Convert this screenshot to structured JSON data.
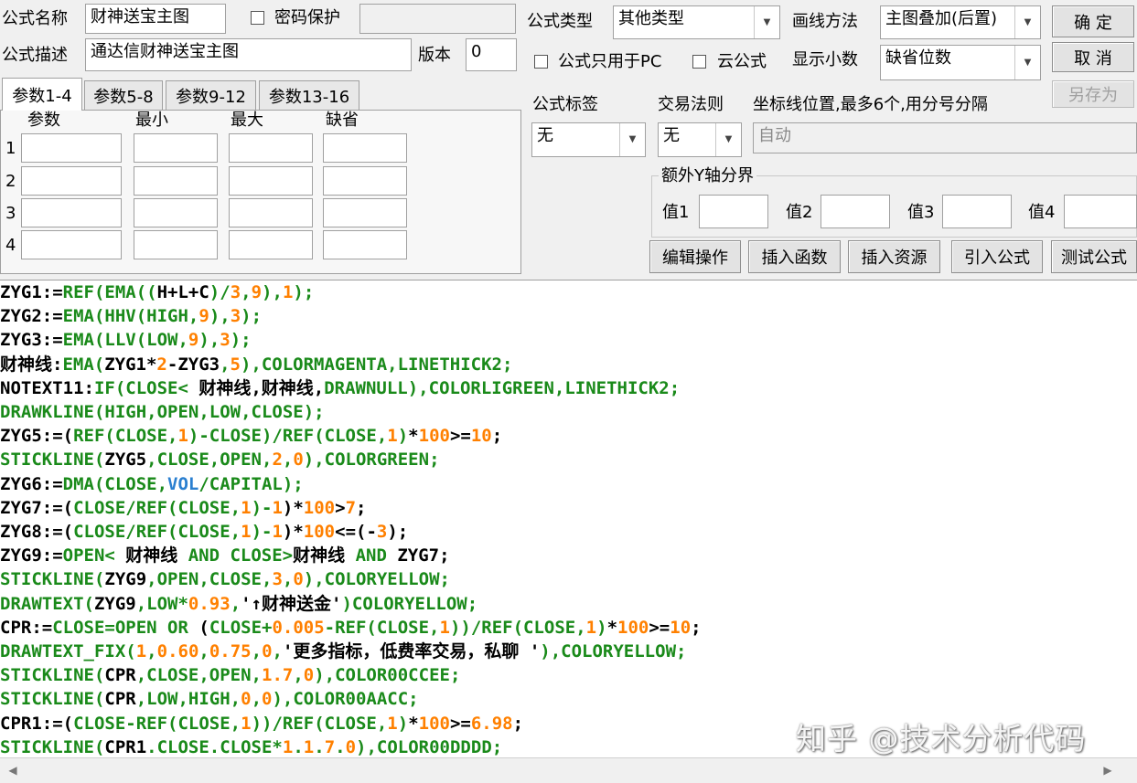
{
  "header": {
    "name_label": "公式名称",
    "name_value": "财神送宝主图",
    "password_label": "密码保护",
    "desc_label": "公式描述",
    "desc_value": "通达信财神送宝主图",
    "version_label": "版本",
    "version_value": "0",
    "type_label": "公式类型",
    "type_value": "其他类型",
    "draw_label": "画线方法",
    "draw_value": "主图叠加(后置)",
    "pc_only_label": "公式只用于PC",
    "cloud_label": "云公式",
    "decimals_label": "显示小数",
    "decimals_value": "缺省位数"
  },
  "buttons": {
    "ok": "确  定",
    "cancel": "取  消",
    "save_as": "另存为",
    "edit_ops": "编辑操作",
    "insert_func": "插入函数",
    "insert_res": "插入资源",
    "import_formula": "引入公式",
    "test_formula": "测试公式"
  },
  "tabs": [
    "参数1-4",
    "参数5-8",
    "参数9-12",
    "参数13-16"
  ],
  "params": {
    "headers": [
      "参数",
      "最小",
      "最大",
      "缺省"
    ],
    "rows": [
      "1",
      "2",
      "3",
      "4"
    ]
  },
  "right": {
    "tag_label": "公式标签",
    "tag_value": "无",
    "trade_label": "交易法则",
    "trade_value": "无",
    "coord_label": "坐标线位置,最多6个,用分号分隔",
    "coord_value": "自动",
    "yaxis_label": "额外Y轴分界",
    "values": [
      "值1",
      "值2",
      "值3",
      "值4"
    ]
  },
  "colors": {
    "default": "#000000",
    "func": "#1a8a1a",
    "num": "#ff8000",
    "blue": "#2a7fd0"
  },
  "code": [
    [
      [
        "d",
        "ZYG1:="
      ],
      [
        "f",
        "REF(EMA(("
      ],
      [
        "d",
        "H+L+C"
      ],
      [
        "f",
        ")/"
      ],
      [
        "n",
        "3"
      ],
      [
        "f",
        ","
      ],
      [
        "n",
        "9"
      ],
      [
        "f",
        "),"
      ],
      [
        "n",
        "1"
      ],
      [
        "f",
        ");"
      ]
    ],
    [
      [
        "d",
        "ZYG2:="
      ],
      [
        "f",
        "EMA(HHV(HIGH,"
      ],
      [
        "n",
        "9"
      ],
      [
        "f",
        "),"
      ],
      [
        "n",
        "3"
      ],
      [
        "f",
        ");"
      ]
    ],
    [
      [
        "d",
        "ZYG3:="
      ],
      [
        "f",
        "EMA(LLV(LOW,"
      ],
      [
        "n",
        "9"
      ],
      [
        "f",
        "),"
      ],
      [
        "n",
        "3"
      ],
      [
        "f",
        ");"
      ]
    ],
    [
      [
        "d",
        "财神线:"
      ],
      [
        "f",
        "EMA("
      ],
      [
        "d",
        "ZYG1*"
      ],
      [
        "n",
        "2"
      ],
      [
        "d",
        "-ZYG3"
      ],
      [
        "f",
        ","
      ],
      [
        "n",
        "5"
      ],
      [
        "f",
        "),COLORMAGENTA,LINETHICK2;"
      ]
    ],
    [
      [
        "d",
        "NOTEXT11:"
      ],
      [
        "f",
        "IF(CLOSE<"
      ],
      [
        "d",
        " 财神线,财神线,"
      ],
      [
        "f",
        "DRAWNULL),COLORLIGREEN,LINETHICK2;"
      ]
    ],
    [
      [
        "f",
        "DRAWKLINE(HIGH,OPEN,LOW,CLOSE);"
      ]
    ],
    [
      [
        "d",
        "ZYG5:=("
      ],
      [
        "f",
        "REF(CLOSE,"
      ],
      [
        "n",
        "1"
      ],
      [
        "f",
        ")-CLOSE)/REF(CLOSE,"
      ],
      [
        "n",
        "1"
      ],
      [
        "f",
        ")"
      ],
      [
        "d",
        "*"
      ],
      [
        "n",
        "100"
      ],
      [
        "d",
        ">="
      ],
      [
        "n",
        "10"
      ],
      [
        "d",
        ";"
      ]
    ],
    [
      [
        "f",
        "STICKLINE("
      ],
      [
        "d",
        "ZYG5"
      ],
      [
        "f",
        ",CLOSE,OPEN,"
      ],
      [
        "n",
        "2"
      ],
      [
        "f",
        ","
      ],
      [
        "n",
        "0"
      ],
      [
        "f",
        "),COLORGREEN;"
      ]
    ],
    [
      [
        "d",
        "ZYG6:="
      ],
      [
        "f",
        "DMA(CLOSE,"
      ],
      [
        "b",
        "VOL"
      ],
      [
        "f",
        "/CAPITAL);"
      ]
    ],
    [
      [
        "d",
        "ZYG7:=("
      ],
      [
        "f",
        "CLOSE/REF(CLOSE,"
      ],
      [
        "n",
        "1"
      ],
      [
        "f",
        ")-"
      ],
      [
        "n",
        "1"
      ],
      [
        "d",
        ")*"
      ],
      [
        "n",
        "100"
      ],
      [
        "d",
        ">"
      ],
      [
        "n",
        "7"
      ],
      [
        "d",
        ";"
      ]
    ],
    [
      [
        "d",
        "ZYG8:=("
      ],
      [
        "f",
        "CLOSE/REF(CLOSE,"
      ],
      [
        "n",
        "1"
      ],
      [
        "f",
        ")-"
      ],
      [
        "n",
        "1"
      ],
      [
        "d",
        ")*"
      ],
      [
        "n",
        "100"
      ],
      [
        "d",
        "<=(-"
      ],
      [
        "n",
        "3"
      ],
      [
        "d",
        ");"
      ]
    ],
    [
      [
        "d",
        "ZYG9:="
      ],
      [
        "f",
        "OPEN<"
      ],
      [
        "d",
        " 财神线 "
      ],
      [
        "f",
        "AND CLOSE>"
      ],
      [
        "d",
        "财神线 "
      ],
      [
        "f",
        "AND"
      ],
      [
        "d",
        " ZYG7;"
      ]
    ],
    [
      [
        "f",
        "STICKLINE("
      ],
      [
        "d",
        "ZYG9"
      ],
      [
        "f",
        ",OPEN,CLOSE,"
      ],
      [
        "n",
        "3"
      ],
      [
        "f",
        ","
      ],
      [
        "n",
        "0"
      ],
      [
        "f",
        "),COLORYELLOW;"
      ]
    ],
    [
      [
        "f",
        "DRAWTEXT("
      ],
      [
        "d",
        "ZYG9"
      ],
      [
        "f",
        ",LOW*"
      ],
      [
        "n",
        "0.93"
      ],
      [
        "f",
        ","
      ],
      [
        "d",
        "'↑财神送金'"
      ],
      [
        "f",
        ")COLORYELLOW;"
      ]
    ],
    [
      [
        "d",
        "CPR:="
      ],
      [
        "f",
        "CLOSE=OPEN OR"
      ],
      [
        "d",
        " ("
      ],
      [
        "f",
        "CLOSE+"
      ],
      [
        "n",
        "0.005"
      ],
      [
        "f",
        "-REF(CLOSE,"
      ],
      [
        "n",
        "1"
      ],
      [
        "f",
        "))/REF(CLOSE,"
      ],
      [
        "n",
        "1"
      ],
      [
        "f",
        ")"
      ],
      [
        "d",
        "*"
      ],
      [
        "n",
        "100"
      ],
      [
        "d",
        ">="
      ],
      [
        "n",
        "10"
      ],
      [
        "d",
        ";"
      ]
    ],
    [
      [
        "f",
        "DRAWTEXT_FIX("
      ],
      [
        "n",
        "1"
      ],
      [
        "f",
        ","
      ],
      [
        "n",
        "0.60"
      ],
      [
        "f",
        ","
      ],
      [
        "n",
        "0.75"
      ],
      [
        "f",
        ","
      ],
      [
        "n",
        "0"
      ],
      [
        "f",
        ","
      ],
      [
        "d",
        "'更多指标，低费率交易，私聊 '"
      ],
      [
        "f",
        "),COLORYELLOW;"
      ]
    ],
    [
      [
        "f",
        "STICKLINE("
      ],
      [
        "d",
        "CPR"
      ],
      [
        "f",
        ",CLOSE,OPEN,"
      ],
      [
        "n",
        "1.7"
      ],
      [
        "f",
        ","
      ],
      [
        "n",
        "0"
      ],
      [
        "f",
        "),COLOR00CCEE;"
      ]
    ],
    [
      [
        "f",
        "STICKLINE("
      ],
      [
        "d",
        "CPR"
      ],
      [
        "f",
        ",LOW,HIGH,"
      ],
      [
        "n",
        "0"
      ],
      [
        "f",
        ","
      ],
      [
        "n",
        "0"
      ],
      [
        "f",
        "),COLOR00AACC;"
      ]
    ],
    [
      [
        "d",
        "CPR1:=("
      ],
      [
        "f",
        "CLOSE-REF(CLOSE,"
      ],
      [
        "n",
        "1"
      ],
      [
        "f",
        "))/REF(CLOSE,"
      ],
      [
        "n",
        "1"
      ],
      [
        "f",
        ")"
      ],
      [
        "d",
        "*"
      ],
      [
        "n",
        "100"
      ],
      [
        "d",
        ">="
      ],
      [
        "n",
        "6.98"
      ],
      [
        "d",
        ";"
      ]
    ],
    [
      [
        "f",
        "STICKLINE("
      ],
      [
        "d",
        "CPR1"
      ],
      [
        "f",
        ".CLOSE.CLOSE*"
      ],
      [
        "n",
        "1"
      ],
      [
        "f",
        "."
      ],
      [
        "n",
        "1"
      ],
      [
        "f",
        "."
      ],
      [
        "n",
        "7"
      ],
      [
        "f",
        "."
      ],
      [
        "n",
        "0"
      ],
      [
        "f",
        "),COLOR00DDDD;"
      ]
    ]
  ],
  "watermark": "知乎 @技术分析代码"
}
